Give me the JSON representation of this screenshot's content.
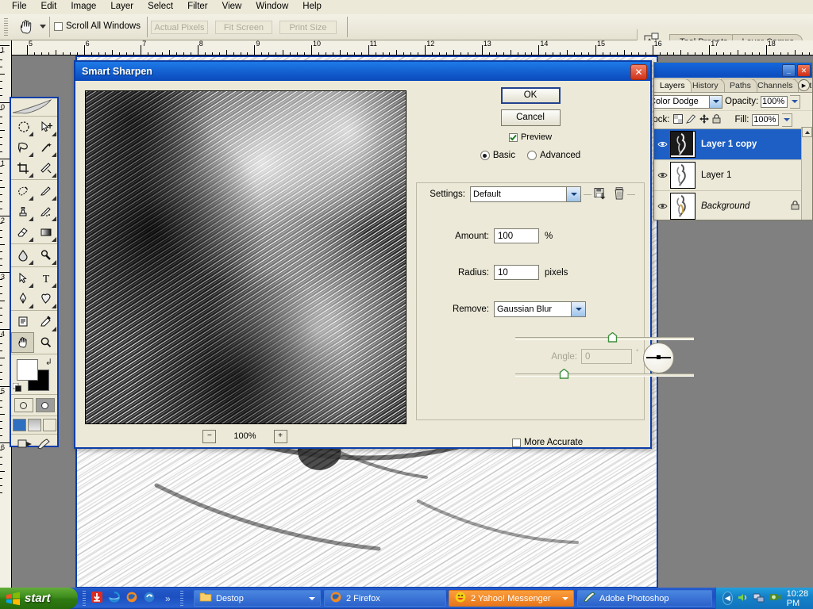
{
  "menubar": {
    "items": [
      "File",
      "Edit",
      "Image",
      "Layer",
      "Select",
      "Filter",
      "View",
      "Window",
      "Help"
    ]
  },
  "options_bar": {
    "tool_icon": "hand-tool-icon",
    "scroll_all_windows_label": "Scroll All Windows",
    "scroll_all_windows_checked": false,
    "buttons": [
      "Actual Pixels",
      "Fit Screen",
      "Print Size"
    ],
    "buttons_disabled": true
  },
  "palette_well": {
    "icon": "palette-well-icon",
    "tabs": [
      "Tool Presets",
      "Layer Comps"
    ]
  },
  "rulers": {
    "unit": "inches",
    "horizontal_labels": [
      "5",
      "6",
      "7",
      "8",
      "9",
      "10",
      "11",
      "12",
      "13",
      "14",
      "15",
      "16",
      "17",
      "18"
    ],
    "vertical_labels": [
      "1",
      "0",
      "1",
      "2",
      "3",
      "4",
      "5",
      "6"
    ]
  },
  "toolbox": {
    "tools": [
      "marquee-elliptical-icon",
      "move-tool-icon",
      "lasso-tool-icon",
      "magic-wand-icon",
      "crop-tool-icon",
      "slice-tool-icon",
      "healing-brush-icon",
      "brush-tool-icon",
      "clone-stamp-icon",
      "history-brush-icon",
      "eraser-tool-icon",
      "gradient-tool-icon",
      "blur-tool-icon",
      "dodge-tool-icon",
      "path-selection-icon",
      "type-tool-icon",
      "pen-tool-icon",
      "custom-shape-icon",
      "notes-tool-icon",
      "eyedropper-icon",
      "hand-tool-icon",
      "zoom-tool-icon"
    ],
    "selected_tool": "hand-tool-icon",
    "foreground_color": "#ffffff",
    "background_color": "#000000"
  },
  "layers_palette": {
    "title_buttons": [
      "minimize-button",
      "close-button"
    ],
    "tabs": [
      "Layers",
      "History",
      "Paths",
      "Channels",
      "Actions"
    ],
    "active_tab": "Layers",
    "blend_mode": "Color Dodge",
    "opacity_label": "Opacity:",
    "opacity_value": "100%",
    "lock_label": "Lock:",
    "lock_icons": [
      "lock-transparency-icon",
      "lock-image-icon",
      "lock-position-icon",
      "lock-all-icon"
    ],
    "fill_label": "Fill:",
    "fill_value": "100%",
    "layers": [
      {
        "name": "Layer 1 copy",
        "selected": true,
        "visible": true,
        "locked": false,
        "italic": false
      },
      {
        "name": "Layer 1",
        "selected": false,
        "visible": true,
        "locked": false,
        "italic": false
      },
      {
        "name": "Background",
        "selected": false,
        "visible": true,
        "locked": true,
        "italic": true
      }
    ]
  },
  "dialog": {
    "title": "Smart Sharpen",
    "close_label": "✕",
    "ok_label": "OK",
    "cancel_label": "Cancel",
    "preview_label": "Preview",
    "preview_checked": true,
    "mode_basic_label": "Basic",
    "mode_advanced_label": "Advanced",
    "mode_selected": "Basic",
    "settings_label": "Settings:",
    "settings_value": "Default",
    "settings_icons": [
      "save-settings-icon",
      "delete-settings-icon"
    ],
    "amount_label": "Amount:",
    "amount_value": "100",
    "amount_unit": "%",
    "amount_slider_pct": 54,
    "radius_label": "Radius:",
    "radius_value": "10",
    "radius_unit": "pixels",
    "radius_slider_pct": 27,
    "remove_label": "Remove:",
    "remove_value": "Gaussian Blur",
    "angle_label": "Angle:",
    "angle_value": "0",
    "angle_unit": "°",
    "angle_disabled": true,
    "more_accurate_label": "More Accurate",
    "more_accurate_checked": false,
    "zoom_out_label": "−",
    "zoom_in_label": "+",
    "zoom_level": "100%"
  },
  "taskbar": {
    "start_label": "start",
    "quick_launch": [
      "download-manager-icon",
      "internet-explorer-icon",
      "firefox-icon",
      "media-player-icon"
    ],
    "quick_launch_more": "»",
    "tasks": [
      {
        "label": "Destop",
        "icon": "folder-icon",
        "style": "blue",
        "has_dropdown": true
      },
      {
        "label": "2 Firefox",
        "icon": "firefox-icon",
        "style": "blue",
        "has_dropdown": false
      },
      {
        "label": "2 Yahoo! Messenger",
        "icon": "yahoo-icon",
        "style": "orange",
        "has_dropdown": true
      },
      {
        "label": "Adobe Photoshop",
        "icon": "photoshop-icon",
        "style": "blue",
        "has_dropdown": false
      }
    ],
    "tray_icons": [
      "show-hidden-icons-arrow",
      "volume-icon",
      "network-icon",
      "webcam-icon"
    ],
    "clock": "10:28 PM"
  }
}
